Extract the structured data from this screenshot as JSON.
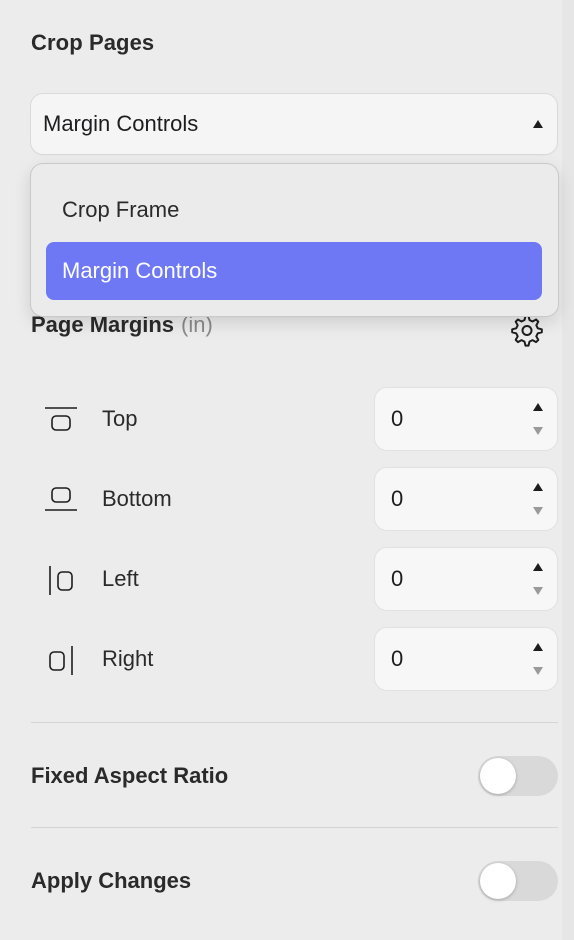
{
  "section": {
    "title": "Crop Pages"
  },
  "mode_select": {
    "value": "Margin Controls",
    "options": [
      "Crop Frame",
      "Margin Controls"
    ],
    "selected_index": 1,
    "highlight_color": "#6e78f5"
  },
  "margins": {
    "title": "Page Margins",
    "unit": "(in)",
    "settings_icon": "gear-icon",
    "rows": [
      {
        "label": "Top",
        "value": "0",
        "icon": "margin-top-icon"
      },
      {
        "label": "Bottom",
        "value": "0",
        "icon": "margin-bottom-icon"
      },
      {
        "label": "Left",
        "value": "0",
        "icon": "margin-left-icon"
      },
      {
        "label": "Right",
        "value": "0",
        "icon": "margin-right-icon"
      }
    ]
  },
  "toggles": {
    "fixed_aspect": {
      "label": "Fixed Aspect Ratio",
      "on": false
    },
    "apply_changes": {
      "label": "Apply Changes",
      "on": false
    }
  }
}
